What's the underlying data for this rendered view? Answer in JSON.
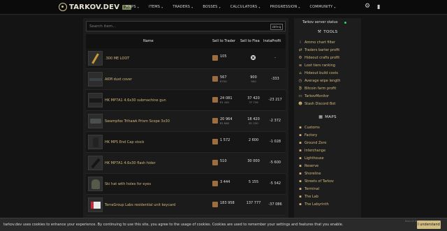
{
  "header": {
    "brand": "TARKOV.DEV",
    "badge": "PVP",
    "nav": [
      "MAPS",
      "ITEMS",
      "TRADERS",
      "BOSSES",
      "CALCULATORS",
      "PROGRESSION",
      "COMMUNITY"
    ],
    "icons": [
      "settings-gear-icon",
      "language-icon"
    ]
  },
  "search": {
    "placeholder": "Search item...",
    "shortcut": "ctrl+q"
  },
  "table": {
    "headers": [
      "Name",
      "Sell to Trader",
      "Sell to Flea",
      "InstaProfit"
    ],
    "rows": [
      {
        "name": ".300 ME LOOT",
        "trader_price": "105",
        "trader_sub": "",
        "flea": "",
        "flea_blocked": true,
        "flea_sub": "",
        "insta": "-"
      },
      {
        "name": "AKM dust cover",
        "trader_price": "567",
        "trader_sub": "₽750",
        "flea": "900",
        "flea_blocked": false,
        "flea_sub": "900",
        "insta": "-333"
      },
      {
        "name": "HK MP7A1 4.6x30 submachine gun",
        "trader_price": "24 081",
        "trader_sub": "₽1 481",
        "flea": "37 420",
        "flea_blocked": false,
        "flea_sub": "37 736",
        "insta": "-23 217"
      },
      {
        "name": "Swampfox Trihawk Prism Scope 3x30",
        "trader_price": "20 964",
        "trader_sub": "₽1 862",
        "flea": "18 420",
        "flea_blocked": false,
        "flea_sub": "₽1 230",
        "insta": "-2 372"
      },
      {
        "name": "HK MP5 End Cap stock",
        "trader_price": "1 572",
        "trader_sub": "",
        "flea": "2 600",
        "flea_blocked": false,
        "flea_sub": "",
        "insta": "-1 028"
      },
      {
        "name": "HK MP7A1 4.6x30 flash hider",
        "trader_price": "510",
        "trader_sub": "",
        "flea": "30 000",
        "flea_blocked": false,
        "flea_sub": "",
        "insta": "-5 600"
      },
      {
        "name": "Ski hat with holes for eyes",
        "trader_price": "3 444",
        "trader_sub": "",
        "flea": "5 155",
        "flea_blocked": false,
        "flea_sub": "",
        "insta": "-5 542"
      },
      {
        "name": "TerraGroup Labs residential unit keycard",
        "trader_price": "183 958",
        "trader_sub": "",
        "flea": "137 777",
        "flea_blocked": false,
        "flea_sub": "",
        "insta": "-37 086"
      }
    ]
  },
  "sidebar": {
    "status_label": "Tarkov server status",
    "status_color": "#2fd36b",
    "tools_title": "TOOLS",
    "tools": [
      {
        "label": "Ammo chart filter",
        "icon": "ammo-icon"
      },
      {
        "label": "Traders barter profit",
        "icon": "barter-icon"
      },
      {
        "label": "Hideout crafts profit",
        "icon": "crafts-icon"
      },
      {
        "label": "Loot tiers ranking",
        "icon": "loot-icon"
      },
      {
        "label": "Hideout build costs",
        "icon": "hideout-icon"
      },
      {
        "label": "Average wipe length",
        "icon": "clock-icon"
      },
      {
        "label": "Bitcoin farm profit",
        "icon": "bitcoin-icon"
      },
      {
        "label": "TarkovMonitor",
        "icon": "monitor-icon"
      },
      {
        "label": "Stash Discord Bot",
        "icon": "discord-icon"
      }
    ],
    "maps_title": "MAPS",
    "maps": [
      "Customs",
      "Factory",
      "Ground Zero",
      "Interchange",
      "Lighthouse",
      "Reserve",
      "Shoreline",
      "Streets of Tarkov",
      "Terminal",
      "The Lab",
      "The Labyrinth"
    ]
  },
  "cookie": {
    "text": "tarkov.dev uses cookies to enhance your experience. By continuing to use this site, you agree to the usage of cookies. Cookies are used to remember your settings and features that you enable.",
    "button": "I understand",
    "faint_text": "Boss of the Battle"
  },
  "colors": {
    "accent": "#d4b97a",
    "background": "#141414",
    "panel": "#1d1d1d",
    "button": "#d2bd85"
  }
}
